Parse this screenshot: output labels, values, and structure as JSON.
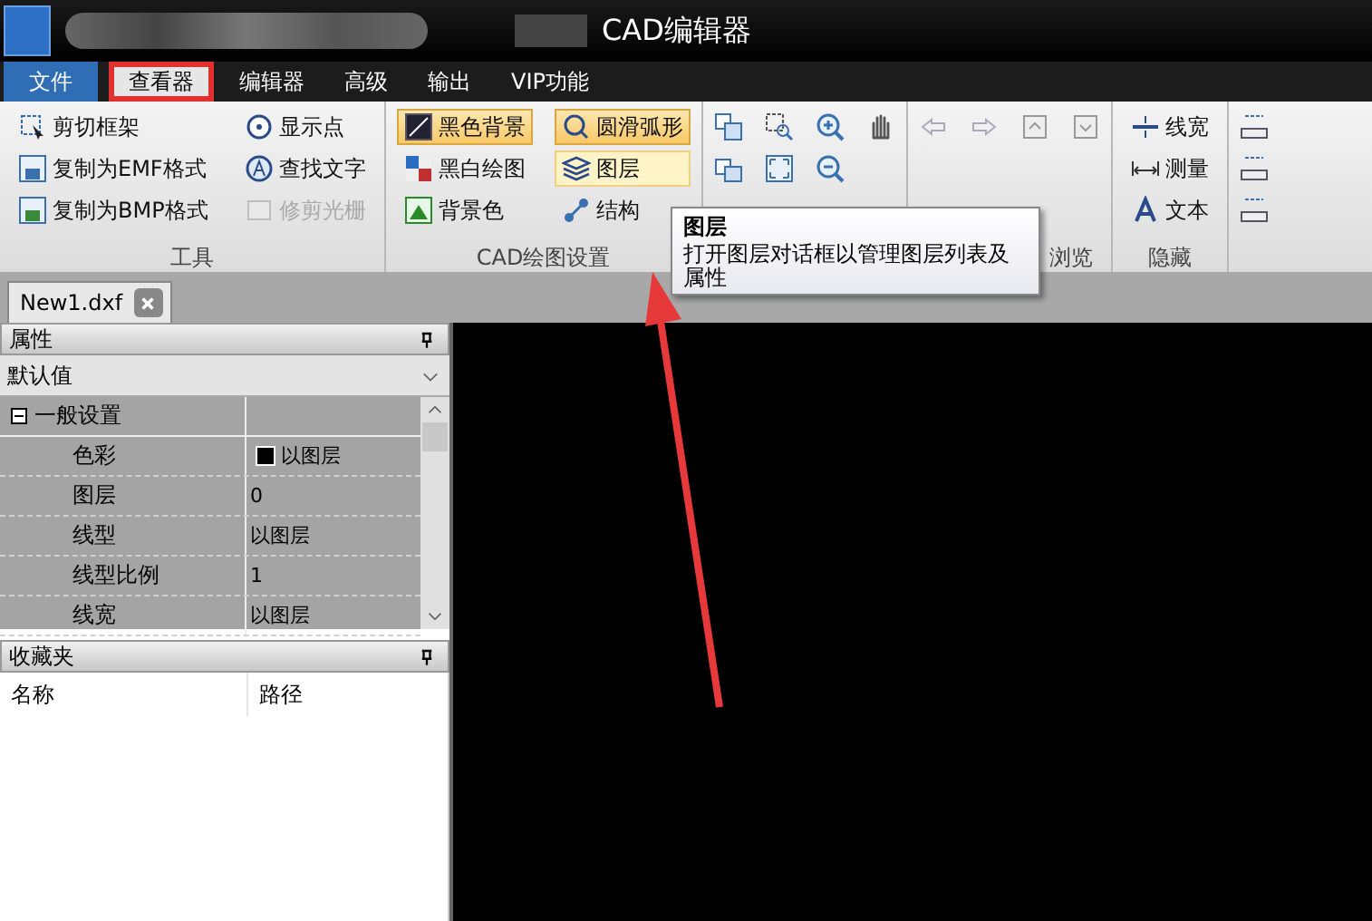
{
  "window": {
    "title": "CAD编辑器"
  },
  "menu_tabs": [
    {
      "label": "文件",
      "selected": false,
      "kind": "file",
      "highlighted": false
    },
    {
      "label": "查看器",
      "selected": true,
      "kind": "tab",
      "highlighted": true
    },
    {
      "label": "编辑器",
      "selected": false,
      "kind": "tab",
      "highlighted": false
    },
    {
      "label": "高级",
      "selected": false,
      "kind": "tab",
      "highlighted": false
    },
    {
      "label": "输出",
      "selected": false,
      "kind": "tab",
      "highlighted": false
    },
    {
      "label": "VIP功能",
      "selected": false,
      "kind": "tab",
      "highlighted": false
    }
  ],
  "ribbon_groups": [
    {
      "kind": "buttons",
      "label": "工具",
      "columns": [
        [
          {
            "label": "剪切框架",
            "disabled": false
          },
          {
            "label": "复制为EMF格式",
            "disabled": false
          },
          {
            "label": "复制为BMP格式",
            "disabled": false
          }
        ],
        [
          {
            "label": "显示点",
            "disabled": false
          },
          {
            "label": "查找文字",
            "disabled": false
          },
          {
            "label": "修剪光栅",
            "disabled": true
          }
        ]
      ]
    },
    {
      "kind": "buttons",
      "label": "CAD绘图设置",
      "columns": [
        [
          {
            "label": "黑色背景",
            "on": true,
            "hover": false
          },
          {
            "label": "黑白绘图",
            "on": false,
            "hover": false
          },
          {
            "label": "背景色",
            "on": false,
            "hover": false
          }
        ],
        [
          {
            "label": "圆滑弧形",
            "on": true,
            "hover": false
          },
          {
            "label": "图层",
            "on": false,
            "hover": true
          },
          {
            "label": "结构",
            "on": false,
            "hover": false
          }
        ]
      ]
    },
    {
      "kind": "icon_grid"
    },
    {
      "kind": "icon_grid",
      "label": "浏览"
    },
    {
      "kind": "buttons",
      "label": "隐藏",
      "columns": [
        [
          {
            "label": "线宽"
          },
          {
            "label": "测量"
          },
          {
            "label": "文本"
          }
        ]
      ]
    },
    {
      "kind": "icon_grid"
    }
  ],
  "tooltip": {
    "title": "图层",
    "text": "打开图层对话框以管理图层列表及属性"
  },
  "document_tabs": [
    {
      "label": "New1.dxf",
      "selected": true
    }
  ],
  "properties_panel": {
    "title": "属性",
    "dropdown": "默认值",
    "category": {
      "label": "一般设置",
      "expanded": true
    },
    "rows": [
      {
        "name": "色彩",
        "value": "以图层",
        "color": "#000000"
      },
      {
        "name": "图层",
        "value": "0"
      },
      {
        "name": "线型",
        "value": "以图层"
      },
      {
        "name": "线型比例",
        "value": "1"
      },
      {
        "name": "线宽",
        "value": "以图层"
      }
    ]
  },
  "favorites_panel": {
    "title": "收藏夹",
    "columns": [
      "名称",
      "路径"
    ]
  }
}
